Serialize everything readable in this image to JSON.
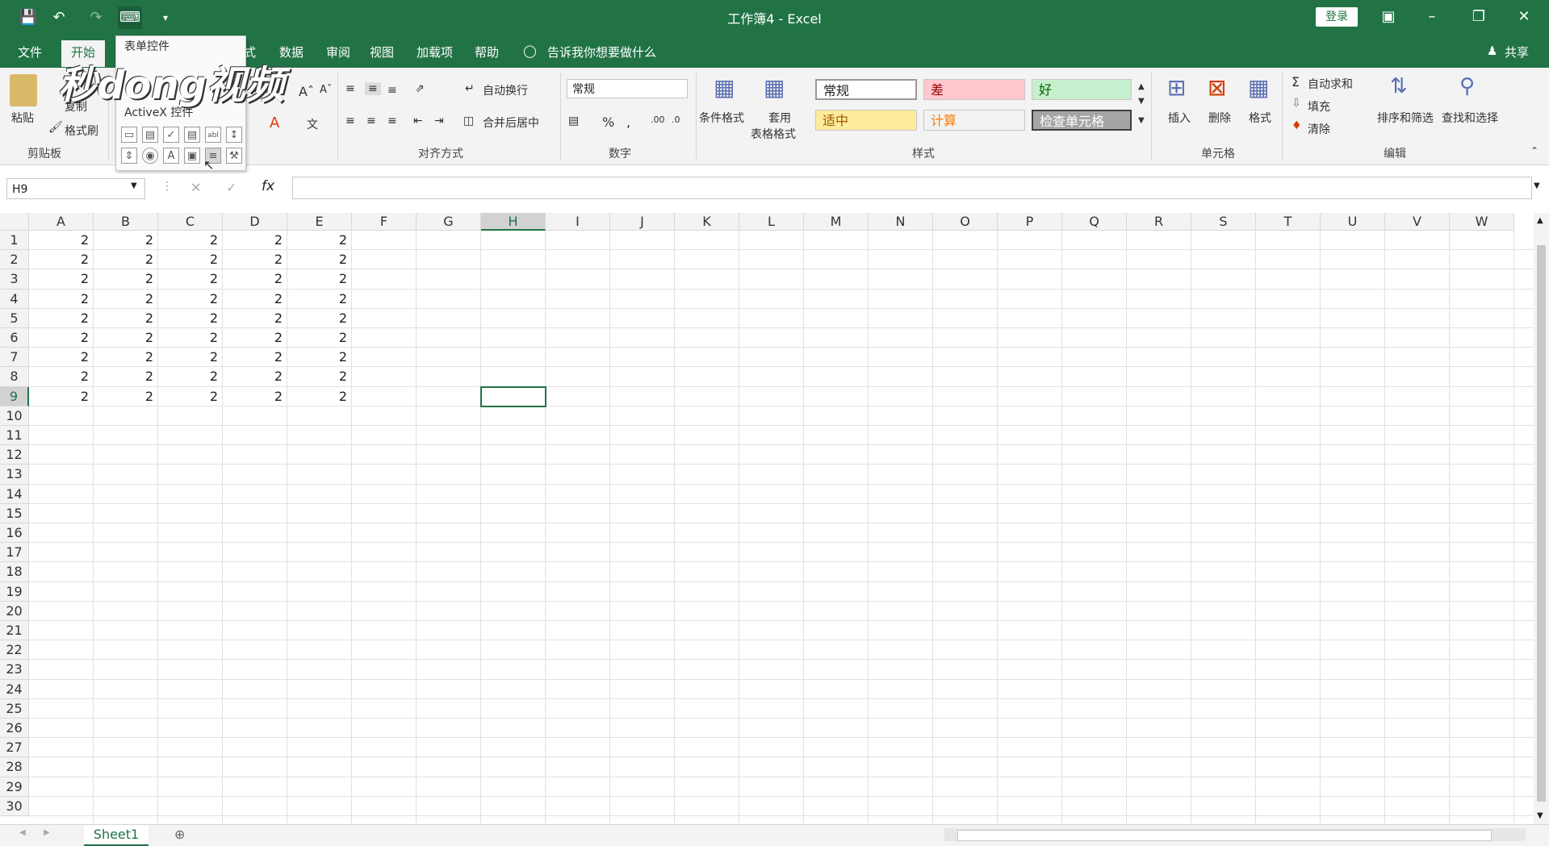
{
  "titlebar": {
    "title": "工作簿4 - Excel",
    "login_label": "登录",
    "qat": [
      "save-icon",
      "undo-icon",
      "redo-icon",
      "form-controls-icon",
      "customize-icon"
    ]
  },
  "menu": {
    "items": [
      "文件",
      "开始",
      "式",
      "数据",
      "审阅",
      "视图",
      "加载项",
      "帮助"
    ],
    "tell_me": "告诉我你想要做什么",
    "share": "共享"
  },
  "ribbon": {
    "clipboard": {
      "paste": "粘贴",
      "copy": "复制",
      "format_painter": "格式刷",
      "label": "剪贴板"
    },
    "alignment": {
      "wrap": "自动换行",
      "merge": "合并后居中",
      "label": "对齐方式"
    },
    "number": {
      "format": "常规",
      "label": "数字"
    },
    "styles": {
      "conditional": "条件格式",
      "table_line1": "套用",
      "table_line2": "表格格式",
      "label": "样式",
      "normal": "常规",
      "bad": "差",
      "good": "好",
      "neutral": "适中",
      "calculation": "计算",
      "check_cell": "检查单元格"
    },
    "cells": {
      "insert": "插入",
      "delete": "删除",
      "format": "格式",
      "label": "单元格"
    },
    "editing": {
      "autosum": "自动求和",
      "fill": "填充",
      "clear": "清除",
      "sort": "排序和筛选",
      "find": "查找和选择",
      "label": "编辑"
    }
  },
  "popup": {
    "title": "表单控件",
    "activex": "ActiveX 控件"
  },
  "watermark": "秒dong视频",
  "formula": {
    "name_box": "H9",
    "fx": "fx",
    "value": ""
  },
  "columns": [
    "A",
    "B",
    "C",
    "D",
    "E",
    "F",
    "G",
    "H",
    "I",
    "J",
    "K",
    "L",
    "M",
    "N",
    "O",
    "P",
    "Q",
    "R",
    "S",
    "T",
    "U",
    "V",
    "W"
  ],
  "rows": [
    "1",
    "2",
    "3",
    "4",
    "5",
    "6",
    "7",
    "8",
    "9",
    "10",
    "11",
    "12",
    "13",
    "14",
    "15",
    "16",
    "17",
    "18",
    "19",
    "20",
    "21",
    "22",
    "23",
    "24",
    "25",
    "26",
    "27",
    "28",
    "29",
    "30"
  ],
  "cells": [
    [
      "2",
      "2",
      "2",
      "2",
      "2"
    ],
    [
      "2",
      "2",
      "2",
      "2",
      "2"
    ],
    [
      "2",
      "2",
      "2",
      "2",
      "2"
    ],
    [
      "2",
      "2",
      "2",
      "2",
      "2"
    ],
    [
      "2",
      "2",
      "2",
      "2",
      "2"
    ],
    [
      "2",
      "2",
      "2",
      "2",
      "2"
    ],
    [
      "2",
      "2",
      "2",
      "2",
      "2"
    ],
    [
      "2",
      "2",
      "2",
      "2",
      "2"
    ],
    [
      "2",
      "2",
      "2",
      "2",
      "2"
    ]
  ],
  "selected_cell": "H9",
  "sheet": {
    "tab": "Sheet1"
  },
  "colors": {
    "accent": "#217346",
    "bad_bg": "#ffc7ce",
    "good_bg": "#c6efce",
    "neutral_bg": "#ffeb9c",
    "check_bg": "#a5a5a5"
  }
}
